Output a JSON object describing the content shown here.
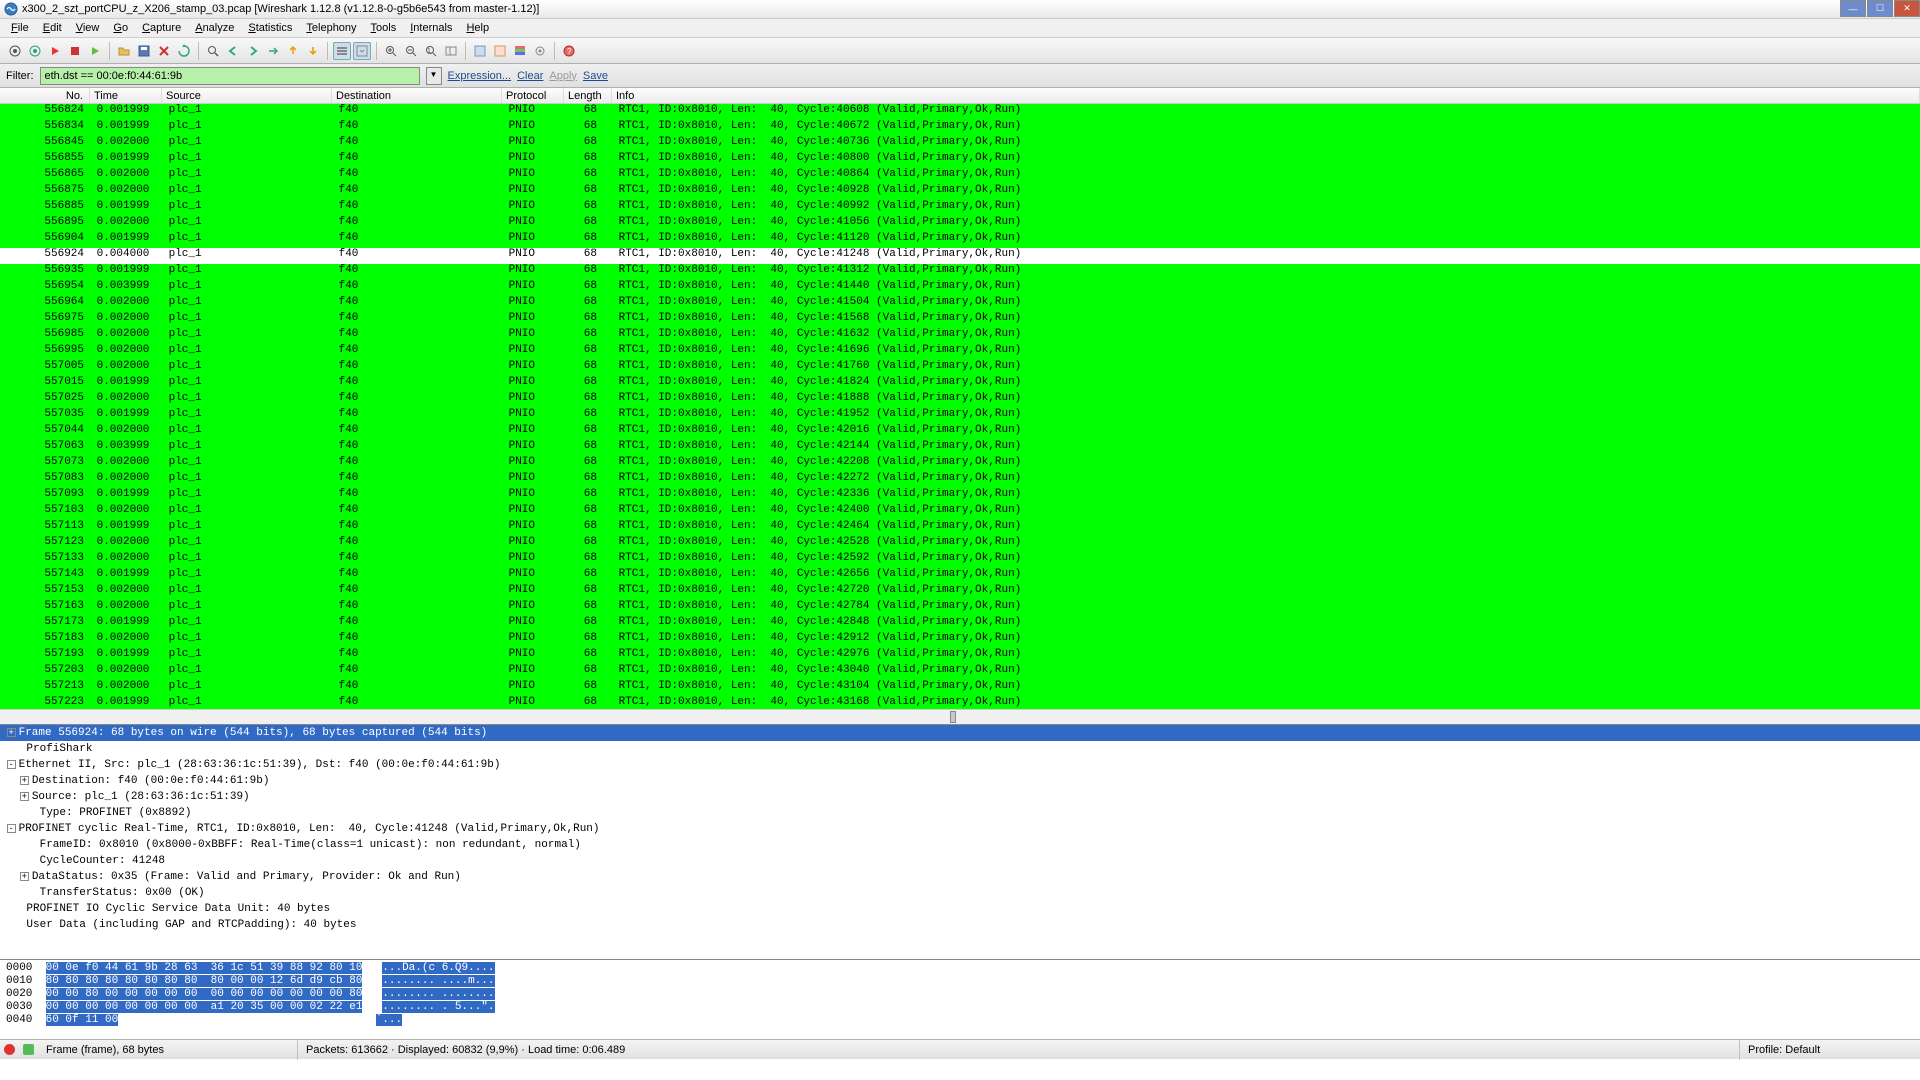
{
  "title": "x300_2_szt_portCPU_z_X206_stamp_03.pcap   [Wireshark 1.12.8  (v1.12.8-0-g5b6e543 from master-1.12)]",
  "menu": [
    "File",
    "Edit",
    "View",
    "Go",
    "Capture",
    "Analyze",
    "Statistics",
    "Telephony",
    "Tools",
    "Internals",
    "Help"
  ],
  "filter": {
    "label": "Filter:",
    "value": "eth.dst == 00:0e:f0:44:61:9b",
    "links": {
      "expr": "Expression...",
      "clear": "Clear",
      "apply": "Apply",
      "save": "Save"
    }
  },
  "cols": {
    "no": "No.",
    "time": "Time",
    "src": "Source",
    "dst": "Destination",
    "proto": "Protocol",
    "len": "Length",
    "info": "Info"
  },
  "rows": [
    {
      "no": "556824",
      "time": "0.001999",
      "src": "plc_1",
      "dst": "f40",
      "proto": "PNIO",
      "len": "68",
      "info": "RTC1, ID:0x8010, Len:  40, Cycle:40608 (Valid,Primary,Ok,Run)",
      "hl": false
    },
    {
      "no": "556834",
      "time": "0.001999",
      "src": "plc_1",
      "dst": "f40",
      "proto": "PNIO",
      "len": "68",
      "info": "RTC1, ID:0x8010, Len:  40, Cycle:40672 (Valid,Primary,Ok,Run)",
      "hl": false
    },
    {
      "no": "556845",
      "time": "0.002000",
      "src": "plc_1",
      "dst": "f40",
      "proto": "PNIO",
      "len": "68",
      "info": "RTC1, ID:0x8010, Len:  40, Cycle:40736 (Valid,Primary,Ok,Run)",
      "hl": false
    },
    {
      "no": "556855",
      "time": "0.001999",
      "src": "plc_1",
      "dst": "f40",
      "proto": "PNIO",
      "len": "68",
      "info": "RTC1, ID:0x8010, Len:  40, Cycle:40800 (Valid,Primary,Ok,Run)",
      "hl": false
    },
    {
      "no": "556865",
      "time": "0.002000",
      "src": "plc_1",
      "dst": "f40",
      "proto": "PNIO",
      "len": "68",
      "info": "RTC1, ID:0x8010, Len:  40, Cycle:40864 (Valid,Primary,Ok,Run)",
      "hl": false
    },
    {
      "no": "556875",
      "time": "0.002000",
      "src": "plc_1",
      "dst": "f40",
      "proto": "PNIO",
      "len": "68",
      "info": "RTC1, ID:0x8010, Len:  40, Cycle:40928 (Valid,Primary,Ok,Run)",
      "hl": false
    },
    {
      "no": "556885",
      "time": "0.001999",
      "src": "plc_1",
      "dst": "f40",
      "proto": "PNIO",
      "len": "68",
      "info": "RTC1, ID:0x8010, Len:  40, Cycle:40992 (Valid,Primary,Ok,Run)",
      "hl": false
    },
    {
      "no": "556895",
      "time": "0.002000",
      "src": "plc_1",
      "dst": "f40",
      "proto": "PNIO",
      "len": "68",
      "info": "RTC1, ID:0x8010, Len:  40, Cycle:41056 (Valid,Primary,Ok,Run)",
      "hl": false
    },
    {
      "no": "556904",
      "time": "0.001999",
      "src": "plc_1",
      "dst": "f40",
      "proto": "PNIO",
      "len": "68",
      "info": "RTC1, ID:0x8010, Len:  40, Cycle:41120 (Valid,Primary,Ok,Run)",
      "hl": false
    },
    {
      "no": "556924",
      "time": "0.004000",
      "src": "plc_1",
      "dst": "f40",
      "proto": "PNIO",
      "len": "68",
      "info": "RTC1, ID:0x8010, Len:  40, Cycle:41248 (Valid,Primary,Ok,Run)",
      "hl": true
    },
    {
      "no": "556935",
      "time": "0.001999",
      "src": "plc_1",
      "dst": "f40",
      "proto": "PNIO",
      "len": "68",
      "info": "RTC1, ID:0x8010, Len:  40, Cycle:41312 (Valid,Primary,Ok,Run)",
      "hl": false
    },
    {
      "no": "556954",
      "time": "0.003999",
      "src": "plc_1",
      "dst": "f40",
      "proto": "PNIO",
      "len": "68",
      "info": "RTC1, ID:0x8010, Len:  40, Cycle:41440 (Valid,Primary,Ok,Run)",
      "hl": false
    },
    {
      "no": "556964",
      "time": "0.002000",
      "src": "plc_1",
      "dst": "f40",
      "proto": "PNIO",
      "len": "68",
      "info": "RTC1, ID:0x8010, Len:  40, Cycle:41504 (Valid,Primary,Ok,Run)",
      "hl": false
    },
    {
      "no": "556975",
      "time": "0.002000",
      "src": "plc_1",
      "dst": "f40",
      "proto": "PNIO",
      "len": "68",
      "info": "RTC1, ID:0x8010, Len:  40, Cycle:41568 (Valid,Primary,Ok,Run)",
      "hl": false
    },
    {
      "no": "556985",
      "time": "0.002000",
      "src": "plc_1",
      "dst": "f40",
      "proto": "PNIO",
      "len": "68",
      "info": "RTC1, ID:0x8010, Len:  40, Cycle:41632 (Valid,Primary,Ok,Run)",
      "hl": false
    },
    {
      "no": "556995",
      "time": "0.002000",
      "src": "plc_1",
      "dst": "f40",
      "proto": "PNIO",
      "len": "68",
      "info": "RTC1, ID:0x8010, Len:  40, Cycle:41696 (Valid,Primary,Ok,Run)",
      "hl": false
    },
    {
      "no": "557005",
      "time": "0.002000",
      "src": "plc_1",
      "dst": "f40",
      "proto": "PNIO",
      "len": "68",
      "info": "RTC1, ID:0x8010, Len:  40, Cycle:41760 (Valid,Primary,Ok,Run)",
      "hl": false
    },
    {
      "no": "557015",
      "time": "0.001999",
      "src": "plc_1",
      "dst": "f40",
      "proto": "PNIO",
      "len": "68",
      "info": "RTC1, ID:0x8010, Len:  40, Cycle:41824 (Valid,Primary,Ok,Run)",
      "hl": false
    },
    {
      "no": "557025",
      "time": "0.002000",
      "src": "plc_1",
      "dst": "f40",
      "proto": "PNIO",
      "len": "68",
      "info": "RTC1, ID:0x8010, Len:  40, Cycle:41888 (Valid,Primary,Ok,Run)",
      "hl": false
    },
    {
      "no": "557035",
      "time": "0.001999",
      "src": "plc_1",
      "dst": "f40",
      "proto": "PNIO",
      "len": "68",
      "info": "RTC1, ID:0x8010, Len:  40, Cycle:41952 (Valid,Primary,Ok,Run)",
      "hl": false
    },
    {
      "no": "557044",
      "time": "0.002000",
      "src": "plc_1",
      "dst": "f40",
      "proto": "PNIO",
      "len": "68",
      "info": "RTC1, ID:0x8010, Len:  40, Cycle:42016 (Valid,Primary,Ok,Run)",
      "hl": false
    },
    {
      "no": "557063",
      "time": "0.003999",
      "src": "plc_1",
      "dst": "f40",
      "proto": "PNIO",
      "len": "68",
      "info": "RTC1, ID:0x8010, Len:  40, Cycle:42144 (Valid,Primary,Ok,Run)",
      "hl": false
    },
    {
      "no": "557073",
      "time": "0.002000",
      "src": "plc_1",
      "dst": "f40",
      "proto": "PNIO",
      "len": "68",
      "info": "RTC1, ID:0x8010, Len:  40, Cycle:42208 (Valid,Primary,Ok,Run)",
      "hl": false
    },
    {
      "no": "557083",
      "time": "0.002000",
      "src": "plc_1",
      "dst": "f40",
      "proto": "PNIO",
      "len": "68",
      "info": "RTC1, ID:0x8010, Len:  40, Cycle:42272 (Valid,Primary,Ok,Run)",
      "hl": false
    },
    {
      "no": "557093",
      "time": "0.001999",
      "src": "plc_1",
      "dst": "f40",
      "proto": "PNIO",
      "len": "68",
      "info": "RTC1, ID:0x8010, Len:  40, Cycle:42336 (Valid,Primary,Ok,Run)",
      "hl": false
    },
    {
      "no": "557103",
      "time": "0.002000",
      "src": "plc_1",
      "dst": "f40",
      "proto": "PNIO",
      "len": "68",
      "info": "RTC1, ID:0x8010, Len:  40, Cycle:42400 (Valid,Primary,Ok,Run)",
      "hl": false
    },
    {
      "no": "557113",
      "time": "0.001999",
      "src": "plc_1",
      "dst": "f40",
      "proto": "PNIO",
      "len": "68",
      "info": "RTC1, ID:0x8010, Len:  40, Cycle:42464 (Valid,Primary,Ok,Run)",
      "hl": false
    },
    {
      "no": "557123",
      "time": "0.002000",
      "src": "plc_1",
      "dst": "f40",
      "proto": "PNIO",
      "len": "68",
      "info": "RTC1, ID:0x8010, Len:  40, Cycle:42528 (Valid,Primary,Ok,Run)",
      "hl": false
    },
    {
      "no": "557133",
      "time": "0.002000",
      "src": "plc_1",
      "dst": "f40",
      "proto": "PNIO",
      "len": "68",
      "info": "RTC1, ID:0x8010, Len:  40, Cycle:42592 (Valid,Primary,Ok,Run)",
      "hl": false
    },
    {
      "no": "557143",
      "time": "0.001999",
      "src": "plc_1",
      "dst": "f40",
      "proto": "PNIO",
      "len": "68",
      "info": "RTC1, ID:0x8010, Len:  40, Cycle:42656 (Valid,Primary,Ok,Run)",
      "hl": false
    },
    {
      "no": "557153",
      "time": "0.002000",
      "src": "plc_1",
      "dst": "f40",
      "proto": "PNIO",
      "len": "68",
      "info": "RTC1, ID:0x8010, Len:  40, Cycle:42720 (Valid,Primary,Ok,Run)",
      "hl": false
    },
    {
      "no": "557163",
      "time": "0.002000",
      "src": "plc_1",
      "dst": "f40",
      "proto": "PNIO",
      "len": "68",
      "info": "RTC1, ID:0x8010, Len:  40, Cycle:42784 (Valid,Primary,Ok,Run)",
      "hl": false
    },
    {
      "no": "557173",
      "time": "0.001999",
      "src": "plc_1",
      "dst": "f40",
      "proto": "PNIO",
      "len": "68",
      "info": "RTC1, ID:0x8010, Len:  40, Cycle:42848 (Valid,Primary,Ok,Run)",
      "hl": false
    },
    {
      "no": "557183",
      "time": "0.002000",
      "src": "plc_1",
      "dst": "f40",
      "proto": "PNIO",
      "len": "68",
      "info": "RTC1, ID:0x8010, Len:  40, Cycle:42912 (Valid,Primary,Ok,Run)",
      "hl": false
    },
    {
      "no": "557193",
      "time": "0.001999",
      "src": "plc_1",
      "dst": "f40",
      "proto": "PNIO",
      "len": "68",
      "info": "RTC1, ID:0x8010, Len:  40, Cycle:42976 (Valid,Primary,Ok,Run)",
      "hl": false
    },
    {
      "no": "557203",
      "time": "0.002000",
      "src": "plc_1",
      "dst": "f40",
      "proto": "PNIO",
      "len": "68",
      "info": "RTC1, ID:0x8010, Len:  40, Cycle:43040 (Valid,Primary,Ok,Run)",
      "hl": false
    },
    {
      "no": "557213",
      "time": "0.002000",
      "src": "plc_1",
      "dst": "f40",
      "proto": "PNIO",
      "len": "68",
      "info": "RTC1, ID:0x8010, Len:  40, Cycle:43104 (Valid,Primary,Ok,Run)",
      "hl": false
    },
    {
      "no": "557223",
      "time": "0.001999",
      "src": "plc_1",
      "dst": "f40",
      "proto": "PNIO",
      "len": "68",
      "info": "RTC1, ID:0x8010, Len:  40, Cycle:43168 (Valid,Primary,Ok,Run)",
      "hl": false
    }
  ],
  "tree": [
    {
      "ind": 0,
      "exp": "+",
      "txt": "Frame 556924: 68 bytes on wire (544 bits), 68 bytes captured (544 bits)",
      "sel": true
    },
    {
      "ind": 0,
      "exp": "",
      "txt": " ProfiShark"
    },
    {
      "ind": 0,
      "exp": "-",
      "txt": "Ethernet II, Src: plc_1 (28:63:36:1c:51:39), Dst: f40 (00:0e:f0:44:61:9b)"
    },
    {
      "ind": 1,
      "exp": "+",
      "txt": "Destination: f40 (00:0e:f0:44:61:9b)"
    },
    {
      "ind": 1,
      "exp": "+",
      "txt": "Source: plc_1 (28:63:36:1c:51:39)"
    },
    {
      "ind": 1,
      "exp": "",
      "txt": " Type: PROFINET (0x8892)"
    },
    {
      "ind": 0,
      "exp": "-",
      "txt": "PROFINET cyclic Real-Time, RTC1, ID:0x8010, Len:  40, Cycle:41248 (Valid,Primary,Ok,Run)"
    },
    {
      "ind": 1,
      "exp": "",
      "txt": " FrameID: 0x8010 (0x8000-0xBBFF: Real-Time(class=1 unicast): non redundant, normal)"
    },
    {
      "ind": 1,
      "exp": "",
      "txt": " CycleCounter: 41248"
    },
    {
      "ind": 1,
      "exp": "+",
      "txt": "DataStatus: 0x35 (Frame: Valid and Primary, Provider: Ok and Run)"
    },
    {
      "ind": 1,
      "exp": "",
      "txt": " TransferStatus: 0x00 (OK)"
    },
    {
      "ind": 0,
      "exp": "",
      "txt": " PROFINET IO Cyclic Service Data Unit: 40 bytes"
    },
    {
      "ind": 0,
      "exp": "",
      "txt": " User Data (including GAP and RTCPadding): 40 bytes"
    }
  ],
  "hex": [
    {
      "off": "0000",
      "h": "00 0e f0 44 61 9b 28 63  36 1c 51 39 88 92 80 10",
      "a": "...Da.(c 6.Q9...."
    },
    {
      "off": "0010",
      "h": "80 80 80 80 80 80 80 80  80 00 00 12 6d d9 cb 80",
      "a": "........ ....m..."
    },
    {
      "off": "0020",
      "h": "00 00 80 00 00 00 00 00  00 00 00 00 00 00 00 80",
      "a": "........ ........"
    },
    {
      "off": "0030",
      "h": "00 00 00 00 00 00 00 00  a1 20 35 00 00 02 22 e1",
      "a": "........ . 5...\"."
    },
    {
      "off": "0040",
      "h": "60 0f 11 00",
      "a": "`..."
    }
  ],
  "status": {
    "frame": "Frame (frame), 68 bytes",
    "pk": "Packets: 613662 · Displayed: 60832 (9,9%) · Load time: 0:06.489",
    "profile": "Profile: Default"
  }
}
